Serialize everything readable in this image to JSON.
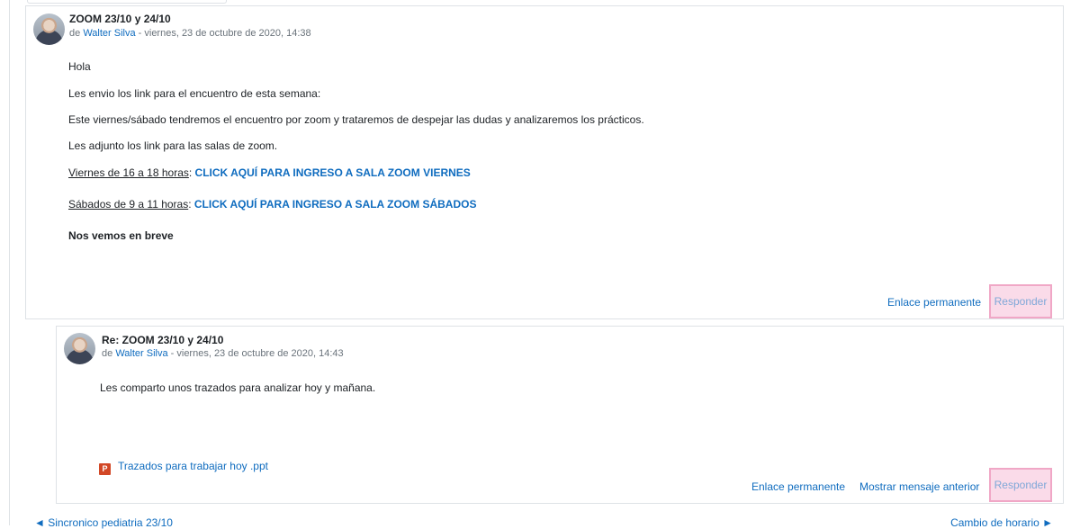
{
  "main_post": {
    "subject": "ZOOM 23/10 y 24/10",
    "by_prefix": "de",
    "author": "Walter Silva",
    "date": " - viernes, 23 de octubre de 2020, 14:38",
    "body": {
      "greeting": "Hola",
      "line1": "Les envio los link para el encuentro de esta semana:",
      "line2": "Este viernes/sábado tendremos el encuentro por zoom y trataremos de despejar las dudas y analizaremos los prácticos.",
      "line3": "Les adjunto los link para las salas de zoom.",
      "friday_label": "Viernes de 16 a 18 horas",
      "friday_link": "CLICK AQUÍ PARA INGRESO A SALA ZOOM VIERNES",
      "saturday_label": "Sábados de 9 a 11 horas",
      "saturday_link": "CLICK AQUÍ PARA INGRESO A SALA ZOOM SÁBADOS",
      "closing": "Nos vemos en breve",
      "colon": ": "
    },
    "actions": {
      "permalink": "Enlace permanente",
      "reply": "Responder"
    }
  },
  "reply_post": {
    "subject": "Re: ZOOM 23/10 y 24/10",
    "by_prefix": "de",
    "author": "Walter Silva",
    "date": " - viernes, 23 de octubre de 2020, 14:43",
    "body": "Les comparto unos trazados para analizar hoy y mañana.",
    "attachment": {
      "icon": "powerpoint-file-icon",
      "icon_glyph": "P",
      "name": "Trazados para trabajar hoy .ppt"
    },
    "actions": {
      "permalink": "Enlace permanente",
      "show_parent": "Mostrar mensaje anterior",
      "reply": "Responder"
    }
  },
  "navigation": {
    "prev": "◄ Sincronico pediatria 23/10",
    "next": "Cambio de horario ►"
  },
  "colors": {
    "link": "#0f6cbf",
    "highlight_border": "#f0a7c6",
    "highlight_fill": "#fadbe9"
  }
}
